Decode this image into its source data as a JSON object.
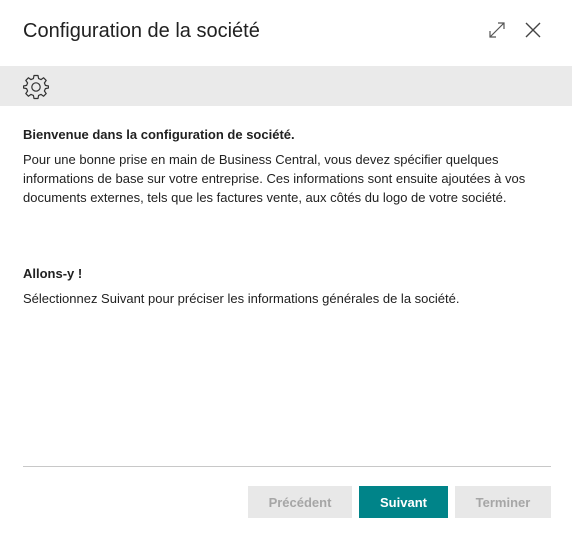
{
  "dialog": {
    "title": "Configuration de la société"
  },
  "content": {
    "welcome_heading": "Bienvenue dans la configuration de société.",
    "welcome_text": "Pour une bonne prise en main de Business Central, vous devez spécifier quelques informations de base sur votre entreprise. Ces informations sont ensuite ajoutées à vos documents externes, tels que les factures vente, aux côtés du logo de votre société.",
    "start_heading": "Allons-y !",
    "start_text": "Sélectionnez Suivant pour préciser les informations générales de la société."
  },
  "buttons": {
    "previous": "Précédent",
    "next": "Suivant",
    "finish": "Terminer"
  },
  "colors": {
    "accent": "#008489",
    "banner": "#eaeaea",
    "disabled_bg": "#e8e8e8",
    "disabled_text": "#a6a6a6"
  }
}
